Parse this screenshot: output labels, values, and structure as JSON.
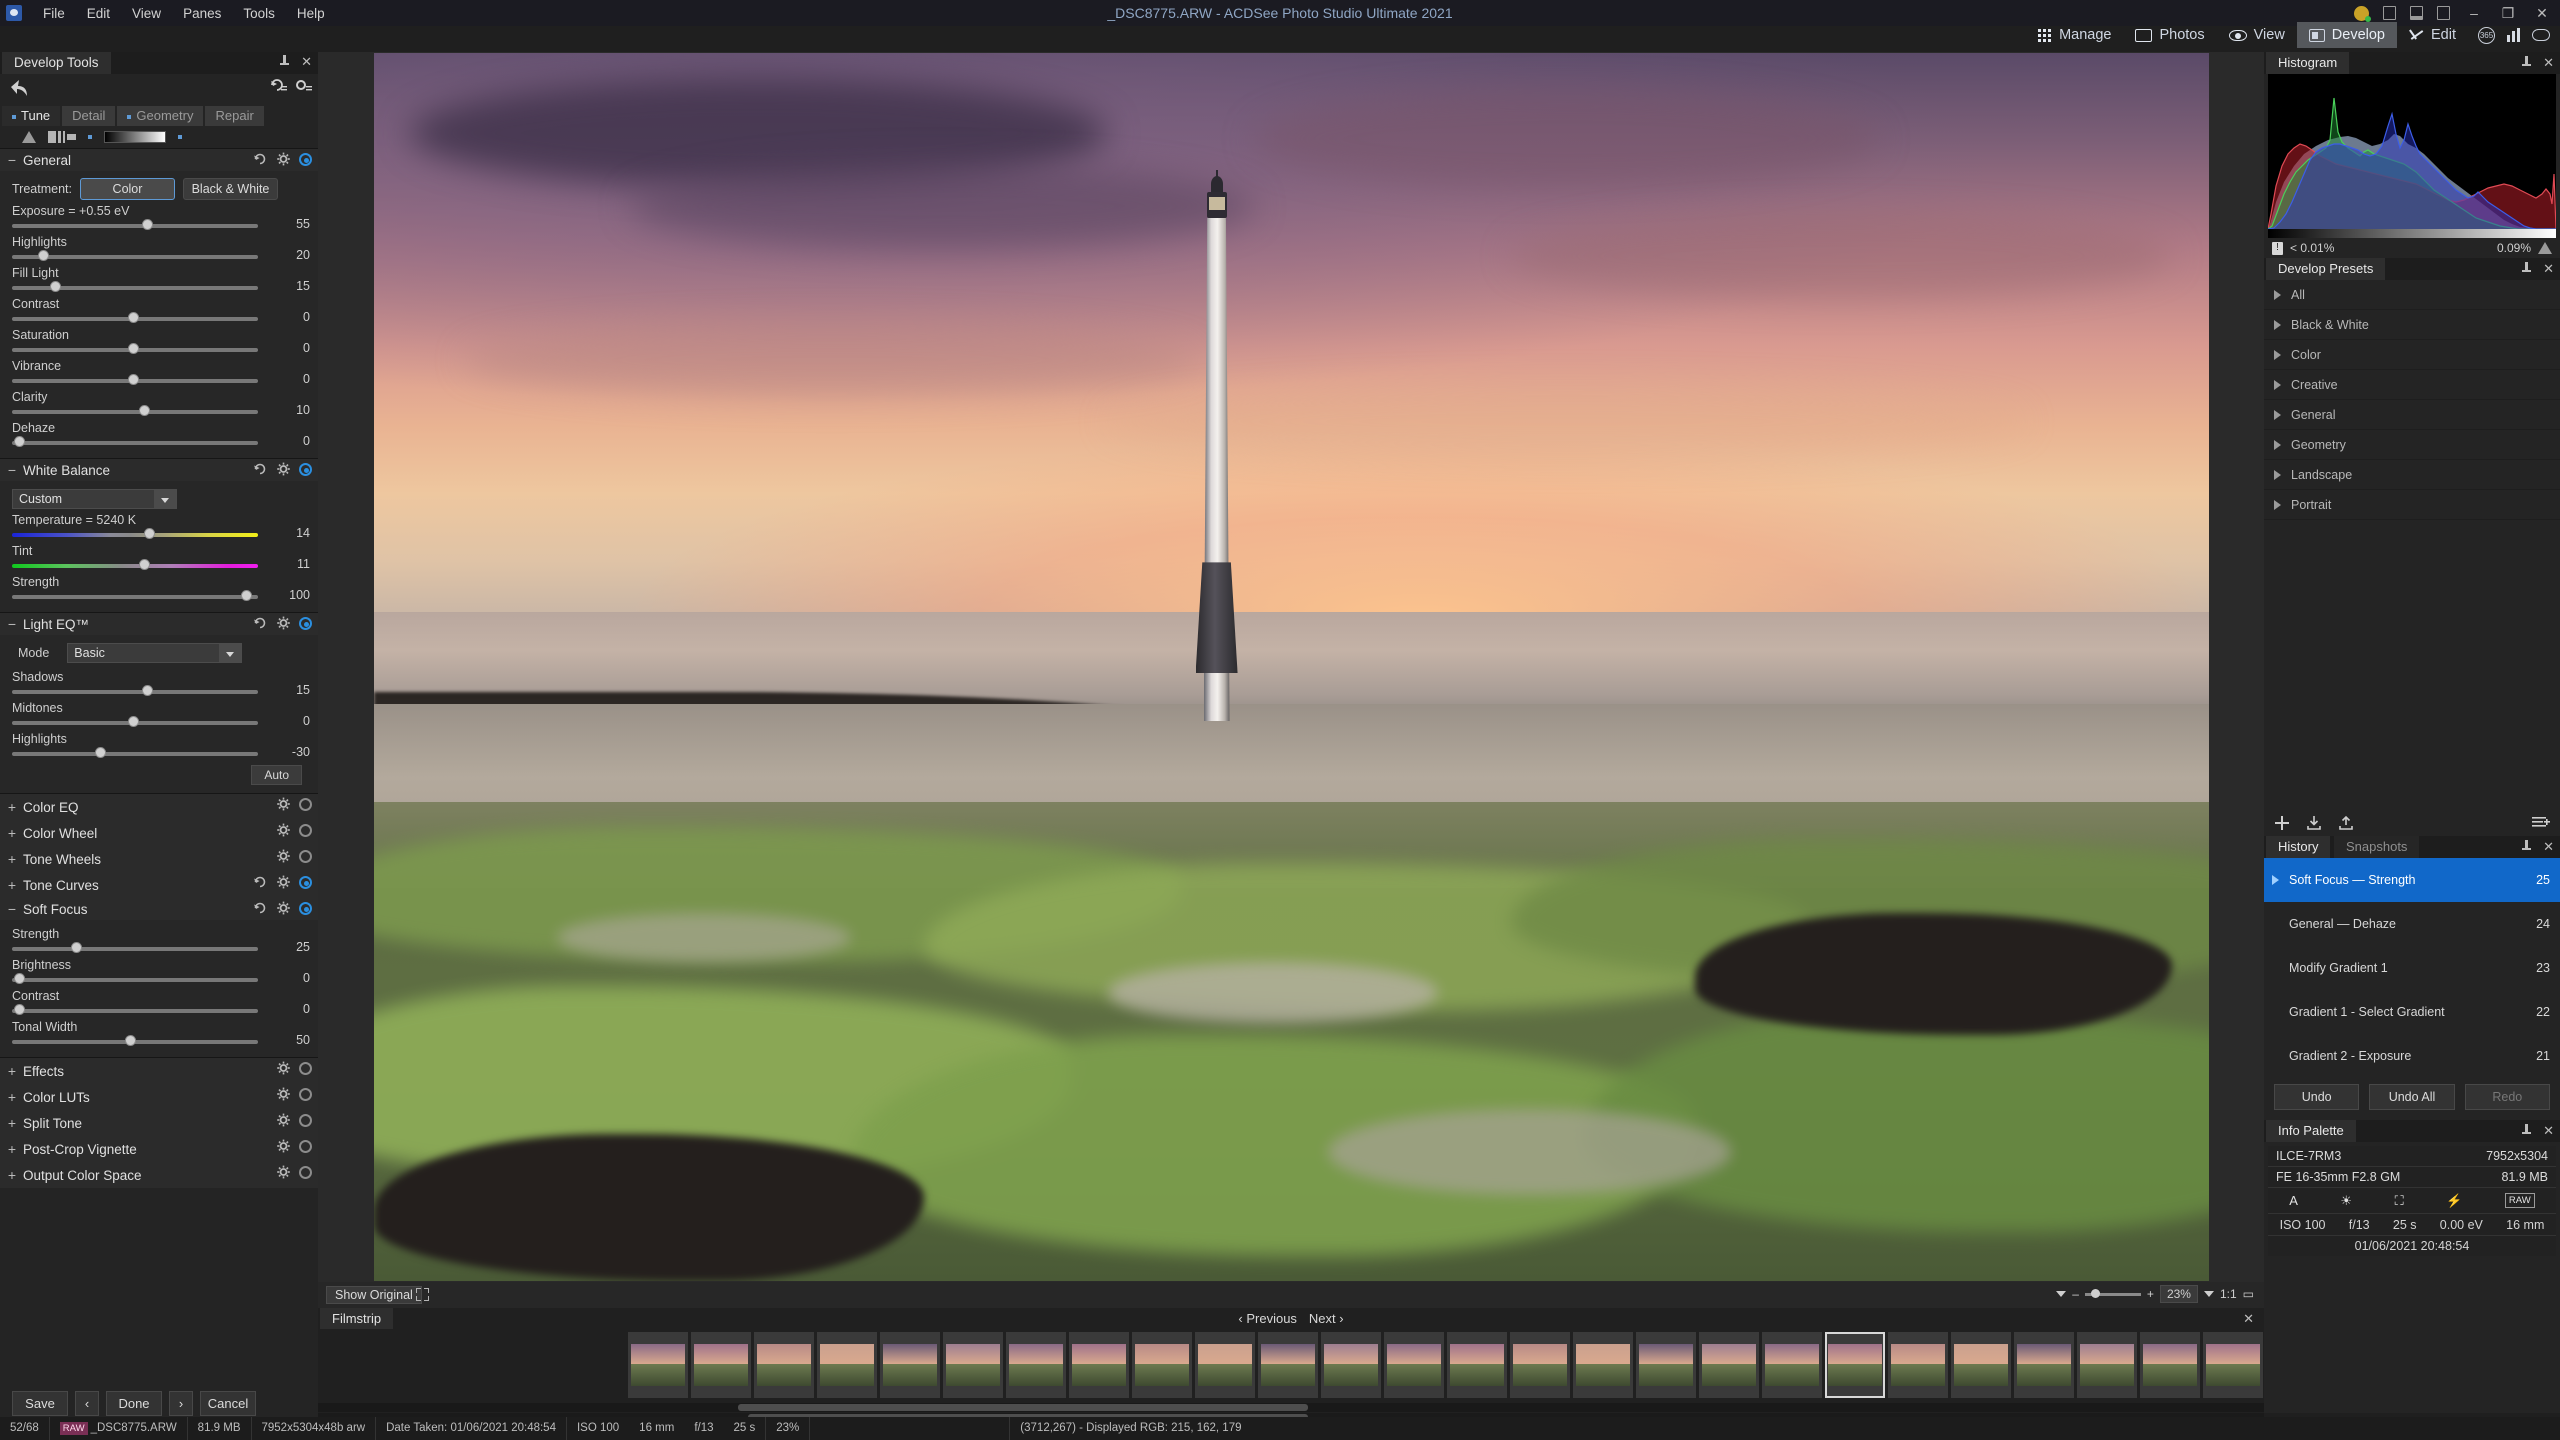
{
  "window": {
    "title": "_DSC8775.ARW - ACDSee Photo Studio Ultimate 2021",
    "menus": [
      "File",
      "Edit",
      "View",
      "Panes",
      "Tools",
      "Help"
    ],
    "minimize": "–",
    "maximize": "❐",
    "close": "✕"
  },
  "modebar": {
    "items": [
      {
        "label": "Manage",
        "icon": "grid-icon",
        "active": false
      },
      {
        "label": "Photos",
        "icon": "photos-icon",
        "active": false
      },
      {
        "label": "View",
        "icon": "eye-icon",
        "active": false
      },
      {
        "label": "Develop",
        "icon": "develop-icon",
        "active": true
      },
      {
        "label": "Edit",
        "icon": "edit-icon",
        "active": false
      }
    ],
    "extra_icons": [
      "365-icon",
      "chart-icon",
      "look-icon"
    ]
  },
  "left_panel": {
    "tab_title": "Develop Tools",
    "tool_tabs": [
      {
        "label": "Tune",
        "active": true,
        "dot": true
      },
      {
        "label": "Detail",
        "active": false,
        "dot": false
      },
      {
        "label": "Geometry",
        "active": false,
        "dot": true
      },
      {
        "label": "Repair",
        "active": false,
        "dot": false
      }
    ],
    "sections": [
      {
        "name": "General",
        "expanded": true,
        "treatment_label": "Treatment:",
        "treatment_options": [
          "Color",
          "Black & White"
        ],
        "treatment_selected": "Color",
        "sliders": [
          {
            "label": "Exposure = +0.55 eV",
            "value": "55",
            "pos": 55
          },
          {
            "label": "Highlights",
            "value": "20",
            "pos": 11
          },
          {
            "label": "Fill Light",
            "value": "15",
            "pos": 16
          },
          {
            "label": "Contrast",
            "value": "0",
            "pos": 49
          },
          {
            "label": "Saturation",
            "value": "0",
            "pos": 49
          },
          {
            "label": "Vibrance",
            "value": "0",
            "pos": 49
          },
          {
            "label": "Clarity",
            "value": "10",
            "pos": 54
          },
          {
            "label": "Dehaze",
            "value": "0",
            "pos": 1
          }
        ]
      },
      {
        "name": "White Balance",
        "expanded": true,
        "preset_value": "Custom",
        "sliders": [
          {
            "label": "Temperature = 5240 K",
            "value": "14",
            "pos": 56,
            "gradient": "temp"
          },
          {
            "label": "Tint",
            "value": "11",
            "pos": 54,
            "gradient": "tint"
          },
          {
            "label": "Strength",
            "value": "100",
            "pos": 97,
            "gradient": "none"
          }
        ]
      },
      {
        "name": "Light EQ™",
        "expanded": true,
        "mode_label": "Mode",
        "mode_value": "Basic",
        "auto_label": "Auto",
        "sliders": [
          {
            "label": "Shadows",
            "value": "15",
            "pos": 55
          },
          {
            "label": "Midtones",
            "value": "0",
            "pos": 49
          },
          {
            "label": "Highlights",
            "value": "-30",
            "pos": 35
          }
        ]
      },
      {
        "name": "Color EQ",
        "expanded": false,
        "active": false
      },
      {
        "name": "Color Wheel",
        "expanded": false,
        "active": false
      },
      {
        "name": "Tone Wheels",
        "expanded": false,
        "active": false
      },
      {
        "name": "Tone Curves",
        "expanded": false,
        "active": true
      },
      {
        "name": "Soft Focus",
        "expanded": true,
        "active": true,
        "sliders": [
          {
            "label": "Strength",
            "value": "25",
            "pos": 25
          },
          {
            "label": "Brightness",
            "value": "0",
            "pos": 1
          },
          {
            "label": "Contrast",
            "value": "0",
            "pos": 1
          },
          {
            "label": "Tonal Width",
            "value": "50",
            "pos": 48
          }
        ]
      },
      {
        "name": "Effects",
        "expanded": false,
        "active": false
      },
      {
        "name": "Color LUTs",
        "expanded": false,
        "active": false
      },
      {
        "name": "Split Tone",
        "expanded": false,
        "active": false
      },
      {
        "name": "Post-Crop Vignette",
        "expanded": false,
        "active": false
      },
      {
        "name": "Output Color Space",
        "expanded": false,
        "active": false
      }
    ],
    "buttons": {
      "save": "Save",
      "prev": "‹",
      "done": "Done",
      "next": "›",
      "cancel": "Cancel"
    }
  },
  "canvas_toolbar": {
    "show_original": "Show Original",
    "zoom_percent": "23%",
    "ratio": "1:1"
  },
  "filmstrip": {
    "tab": "Filmstrip",
    "previous": "Previous",
    "next": "Next",
    "close": "✕",
    "selected_index": 19,
    "count": 27
  },
  "right_panel": {
    "histogram": {
      "title": "Histogram",
      "clipped_shadows": "< 0.01%",
      "clipped_highlights": "0.09%"
    },
    "presets": {
      "title": "Develop Presets",
      "items": [
        "All",
        "Black & White",
        "Color",
        "Creative",
        "General",
        "Geometry",
        "Landscape",
        "Portrait"
      ]
    },
    "history": {
      "tab": "History",
      "tab2": "Snapshots",
      "items": [
        {
          "label": "Soft Focus — Strength",
          "num": "25",
          "selected": true
        },
        {
          "label": "General — Dehaze",
          "num": "24",
          "selected": false
        },
        {
          "label": "Modify Gradient 1",
          "num": "23",
          "selected": false
        },
        {
          "label": "Gradient 1 - Select Gradient",
          "num": "22",
          "selected": false
        },
        {
          "label": "Gradient 2 - Exposure",
          "num": "21",
          "selected": false
        }
      ],
      "undo": "Undo",
      "undo_all": "Undo All",
      "redo": "Redo"
    },
    "info_palette": {
      "title": "Info Palette",
      "camera": "ILCE-7RM3",
      "lens": "FE 16-35mm F2.8 GM",
      "dimensions": "7952x5304",
      "filesize": "81.9 MB",
      "icons": [
        "A",
        "sun-icon",
        "metering-icon",
        "flash-off-icon",
        "RAW"
      ],
      "values": [
        "ISO 100",
        "f/13",
        "25 s",
        "0.00 eV",
        "16 mm"
      ],
      "date": "01/06/2021 20:48:54"
    }
  },
  "statusbar": {
    "index": "52/68",
    "raw_tag": "RAW",
    "filename": "_DSC8775.ARW",
    "filesize": "81.9 MB",
    "dims": "7952x5304x48b arw",
    "date_taken": "Date Taken: 01/06/2021 20:48:54",
    "iso": "ISO 100",
    "focal": "16 mm",
    "aperture": "f/13",
    "shutter": "25 s",
    "zoom": "23%",
    "cursor": "(3712,267) - Displayed RGB: 215, 162, 179"
  },
  "colors": {
    "accent": "#1168c9",
    "toggle_border": "#5e9ad6",
    "panel_bg": "#242424",
    "title_text": "#8fa6c4"
  }
}
